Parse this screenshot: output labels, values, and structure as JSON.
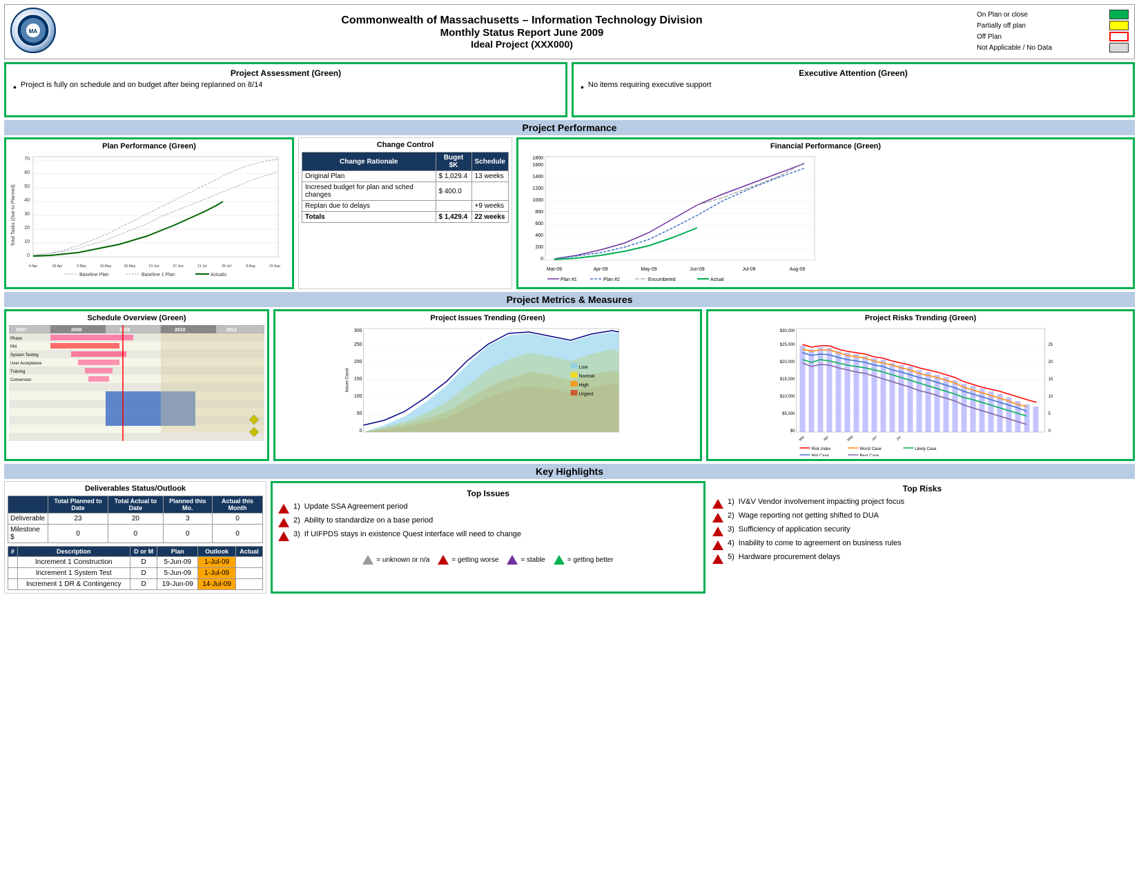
{
  "header": {
    "title_line1": "Commonwealth of Massachusetts – Information Technology Division",
    "title_line2": "Monthly Status Report June 2009",
    "title_line3": "Ideal Project (XXX000)"
  },
  "legend": {
    "items": [
      {
        "label": "On Plan or close",
        "color": "#00b050",
        "bg": "#00b050"
      },
      {
        "label": "Partially off plan",
        "color": "#ffff00",
        "bg": "#ffff00"
      },
      {
        "label": "Off Plan",
        "color": "#ff0000",
        "bg": "#ff0000"
      },
      {
        "label": "Not Applicable / No Data",
        "color": "#d9d9d9",
        "bg": "#d9d9d9"
      }
    ]
  },
  "project_assessment": {
    "title": "Project Assessment (Green)",
    "content": "Project is fully on schedule and on budget after being replanned on 8/14"
  },
  "executive_attention": {
    "title": "Executive Attention (Green)",
    "content": "No items requiring executive support"
  },
  "project_performance_header": "Project Performance",
  "plan_performance": {
    "title": "Plan Performance (Green)"
  },
  "change_control": {
    "title": "Change Control",
    "columns": [
      "Change Rationale",
      "Buget $K",
      "Schedule"
    ],
    "rows": [
      {
        "rationale": "Original Plan",
        "budget": "$ 1,029.4",
        "schedule": "13 weeks"
      },
      {
        "rationale": "Incresed budget for plan and sched changes",
        "budget": "$   400.0",
        "schedule": ""
      },
      {
        "rationale": "Replan due to delays",
        "budget": "",
        "schedule": "+9 weeks"
      },
      {
        "rationale": "Totals",
        "budget": "$  1,429.4",
        "schedule": "22 weeks"
      }
    ]
  },
  "financial_performance": {
    "title": "Financial Performance (Green)",
    "legend": [
      "Plan #1",
      "Plan #2",
      "Encumbered",
      "Actual"
    ]
  },
  "project_metrics_header": "Project Metrics & Measures",
  "schedule_overview": {
    "title": "Schedule Overview (Green)"
  },
  "project_issues": {
    "title": "Project Issues Trending (Green)",
    "legend": [
      "Low",
      "Normal",
      "High",
      "Urgent"
    ]
  },
  "project_risks": {
    "title": "Project Risks Trending (Green)",
    "legend": [
      "Risk Index",
      "Worst Case",
      "Likely Case",
      "Mid Case",
      "Best Case"
    ]
  },
  "key_highlights_header": "Key Highlights",
  "deliverables": {
    "title": "Deliverables Status/Outlook",
    "columns": [
      "",
      "Total Planned to Date",
      "Total Actual to Date",
      "Planned this Mo.",
      "Actual this Month"
    ],
    "summary_rows": [
      {
        "name": "Deliverable",
        "planned": "23",
        "actual": "20",
        "planned_mo": "3",
        "actual_mo": "0"
      },
      {
        "name": "Milestone $",
        "planned": "0",
        "actual": "0",
        "planned_mo": "0",
        "actual_mo": "0"
      }
    ],
    "detail_columns": [
      "#",
      "Description",
      "D or M",
      "Plan",
      "Outlook",
      "Actual"
    ],
    "detail_rows": [
      {
        "num": "",
        "desc": "Increment 1 Construction",
        "dm": "D",
        "plan": "5-Jun-09",
        "outlook": "1-Jul-09",
        "actual": "",
        "outlook_color": "orange"
      },
      {
        "num": "",
        "desc": "Increment 1 System Test",
        "dm": "D",
        "plan": "5-Jun-09",
        "outlook": "1-Jul-09",
        "actual": "",
        "outlook_color": "orange"
      },
      {
        "num": "",
        "desc": "Increment 1 DR & Contingency",
        "dm": "D",
        "plan": "19-Jun-09",
        "outlook": "14-Jul-09",
        "actual": "",
        "outlook_color": "orange"
      }
    ]
  },
  "top_issues": {
    "title": "Top Issues",
    "items": [
      {
        "text": "Update SSA Agreement period",
        "type": "red"
      },
      {
        "text": "Ability to standardize on a base period",
        "type": "red"
      },
      {
        "text": "If UIFPDS stays in existence Quest interface will need to change",
        "type": "red"
      }
    ]
  },
  "top_risks": {
    "title": "Top Risks",
    "items": [
      {
        "text": "IV&V Vendor involvement impacting project focus",
        "type": "red"
      },
      {
        "text": "Wage reporting not getting shifted to DUA",
        "type": "red"
      },
      {
        "text": "Sufficiency of application security",
        "type": "red"
      },
      {
        "text": "Inability to come to agreement on business rules",
        "type": "red"
      },
      {
        "text": "Hardware procurement delays",
        "type": "red"
      }
    ]
  },
  "bottom_legend": {
    "items": [
      {
        "label": "= unknown or n/a",
        "type": "gray"
      },
      {
        "label": "= getting worse",
        "type": "red"
      },
      {
        "label": "= stable",
        "type": "purple"
      },
      {
        "label": "= getting better",
        "type": "green"
      }
    ]
  }
}
